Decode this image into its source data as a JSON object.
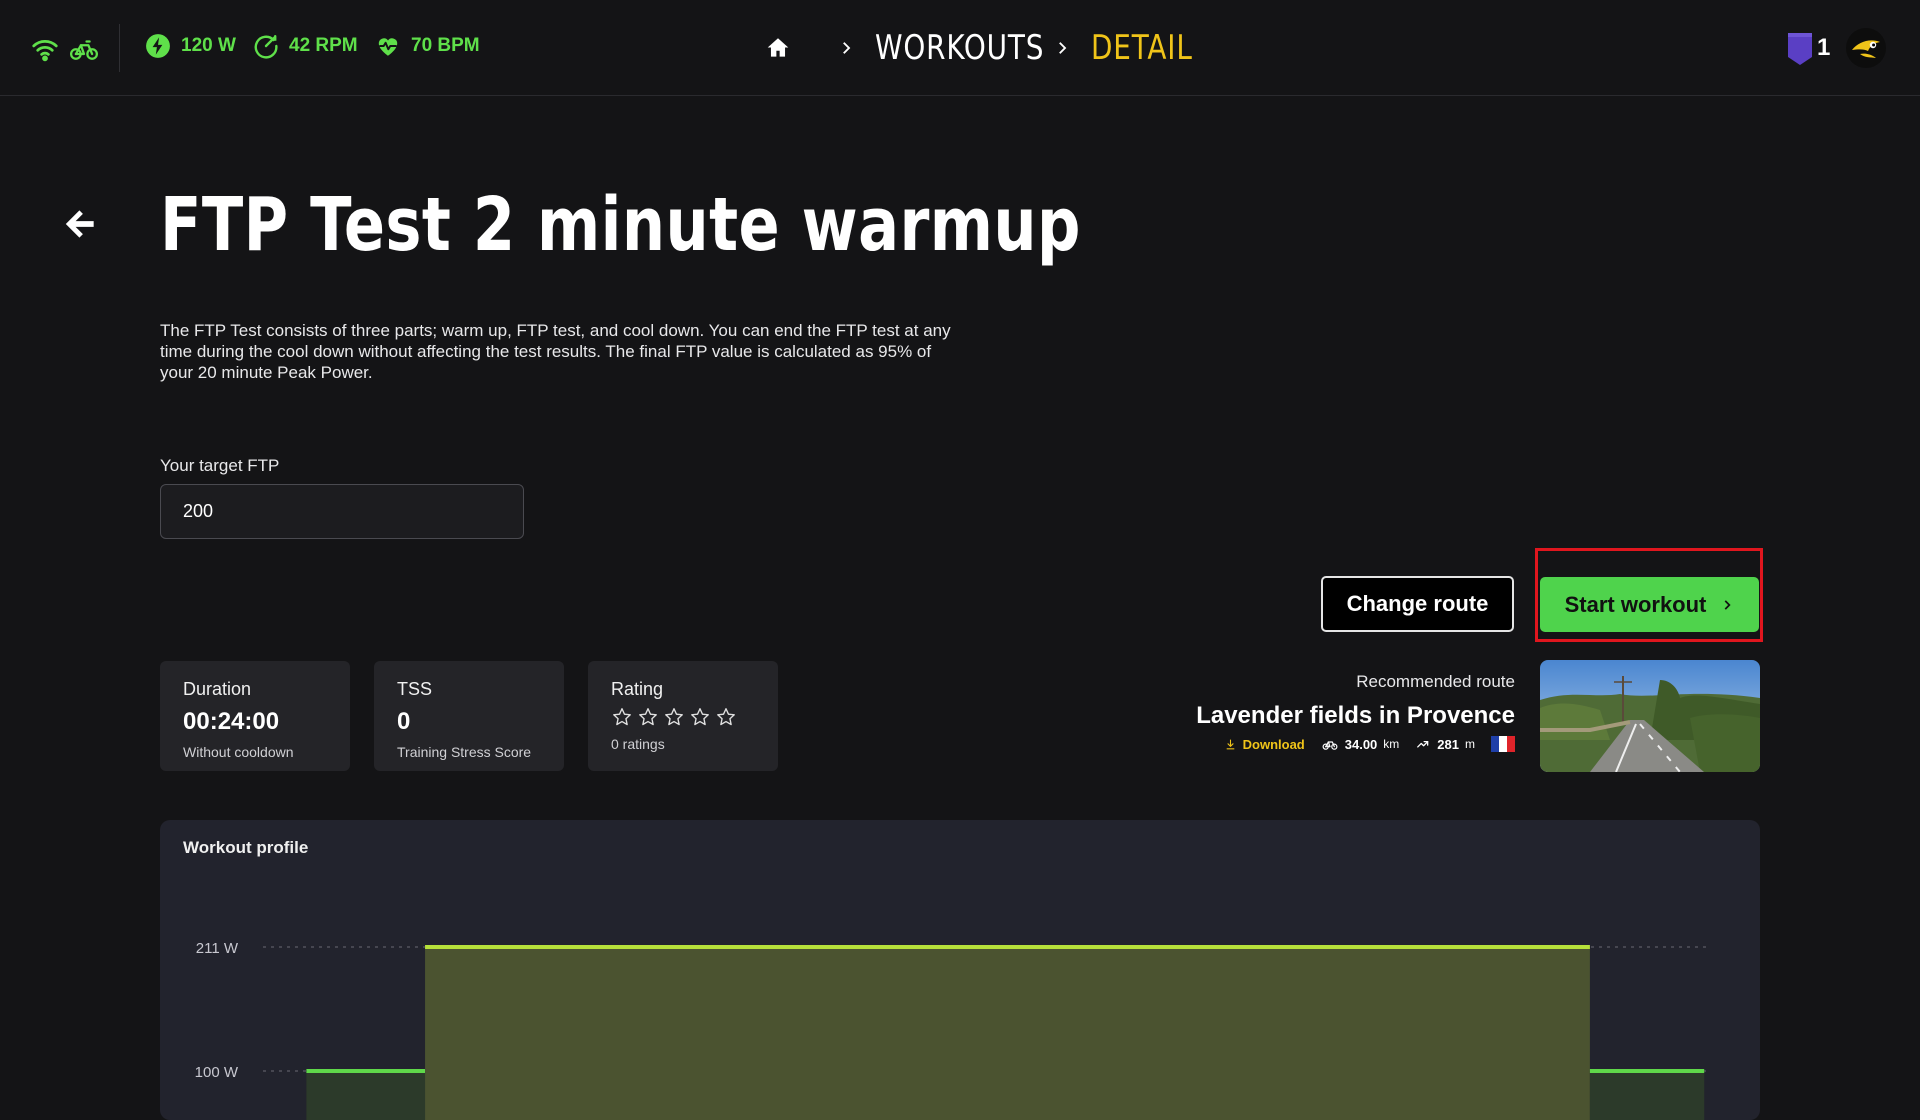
{
  "topbar": {
    "metrics": [
      {
        "icon": "power-bolt-icon",
        "value": "120 W"
      },
      {
        "icon": "cadence-gauge-icon",
        "value": "42 RPM"
      },
      {
        "icon": "heart-rate-icon",
        "value": "70 BPM"
      }
    ],
    "breadcrumb": {
      "workouts": "WORKOUTS",
      "detail": "DETAIL"
    },
    "level": "1"
  },
  "workout": {
    "title": "FTP Test 2 minute warmup",
    "description": "The FTP Test consists of three parts; warm up, FTP test, and cool down. You can end the FTP test at any time during the cool down without affecting the test results. The final FTP value is calculated as 95% of your 20 minute Peak Power."
  },
  "ftp": {
    "label": "Your target FTP",
    "value": "200"
  },
  "buttons": {
    "change_route": "Change route",
    "start_workout": "Start workout"
  },
  "stats": {
    "duration": {
      "label": "Duration",
      "value": "00:24:00",
      "sub": "Without cooldown"
    },
    "tss": {
      "label": "TSS",
      "value": "0",
      "sub": "Training Stress Score"
    },
    "rating": {
      "label": "Rating",
      "stars": 0,
      "sub": "0 ratings"
    }
  },
  "route": {
    "label": "Recommended route",
    "name": "Lavender fields in Provence",
    "download": "Download",
    "distance": "34.00",
    "distance_unit": "km",
    "elevation": "281",
    "elevation_unit": "m",
    "country_flag_colors": [
      "#1f3fa8",
      "#ffffff",
      "#e0242a"
    ]
  },
  "colors": {
    "accent_green": "#4fd34c",
    "accent_yellow": "#f0c419",
    "highlight_red": "#e0161e"
  },
  "chart_data": {
    "type": "area",
    "title": "Workout profile",
    "yticks": [
      "211 W",
      "100 W"
    ],
    "ytick_values": [
      211,
      100
    ],
    "ylim": [
      80,
      211
    ],
    "xlim": [
      0,
      100
    ],
    "series": [
      {
        "values": [
          [
            3,
            100
          ],
          [
            11.2,
            100
          ]
        ]
      },
      {
        "values": [
          [
            11.2,
            211
          ],
          [
            91.7,
            211
          ]
        ]
      },
      {
        "values": [
          [
            91.7,
            100
          ],
          [
            99.6,
            100
          ]
        ]
      }
    ]
  }
}
